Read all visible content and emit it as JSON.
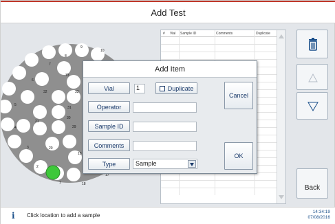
{
  "window": {
    "title": "Add Test"
  },
  "carousel": {
    "numbers": [
      "9",
      "10",
      "8",
      "7",
      "73",
      "6",
      "32",
      "32",
      "5",
      "31",
      "21",
      "30",
      "29",
      "4",
      "20",
      "3",
      "19",
      "2",
      "1",
      "18",
      "17"
    ],
    "selected_color": "#3ec83a"
  },
  "table": {
    "headers": [
      "#",
      "Vial",
      "Sample ID",
      "Comments",
      "Duplicate"
    ]
  },
  "dialog": {
    "title": "Add Item",
    "vial_label": "Vial",
    "vial_value": "1",
    "duplicate_label": "Duplicate",
    "operator_label": "Operator",
    "operator_value": "",
    "sample_id_label": "Sample ID",
    "sample_id_value": "",
    "comments_label": "Comments",
    "comments_value": "",
    "type_label": "Type",
    "type_value": "Sample",
    "cancel_label": "Cancel",
    "ok_label": "OK"
  },
  "side_buttons": {
    "delete_icon": "trash-icon",
    "up_icon": "triangle-up-icon",
    "down_icon": "triangle-down-icon",
    "back_label": "Back"
  },
  "status": {
    "message": "Click location to add a sample",
    "time": "14:34:19",
    "date": "07/08/2016"
  },
  "colors": {
    "accent": "#1a4f8a",
    "title_rule": "#c0392b"
  }
}
